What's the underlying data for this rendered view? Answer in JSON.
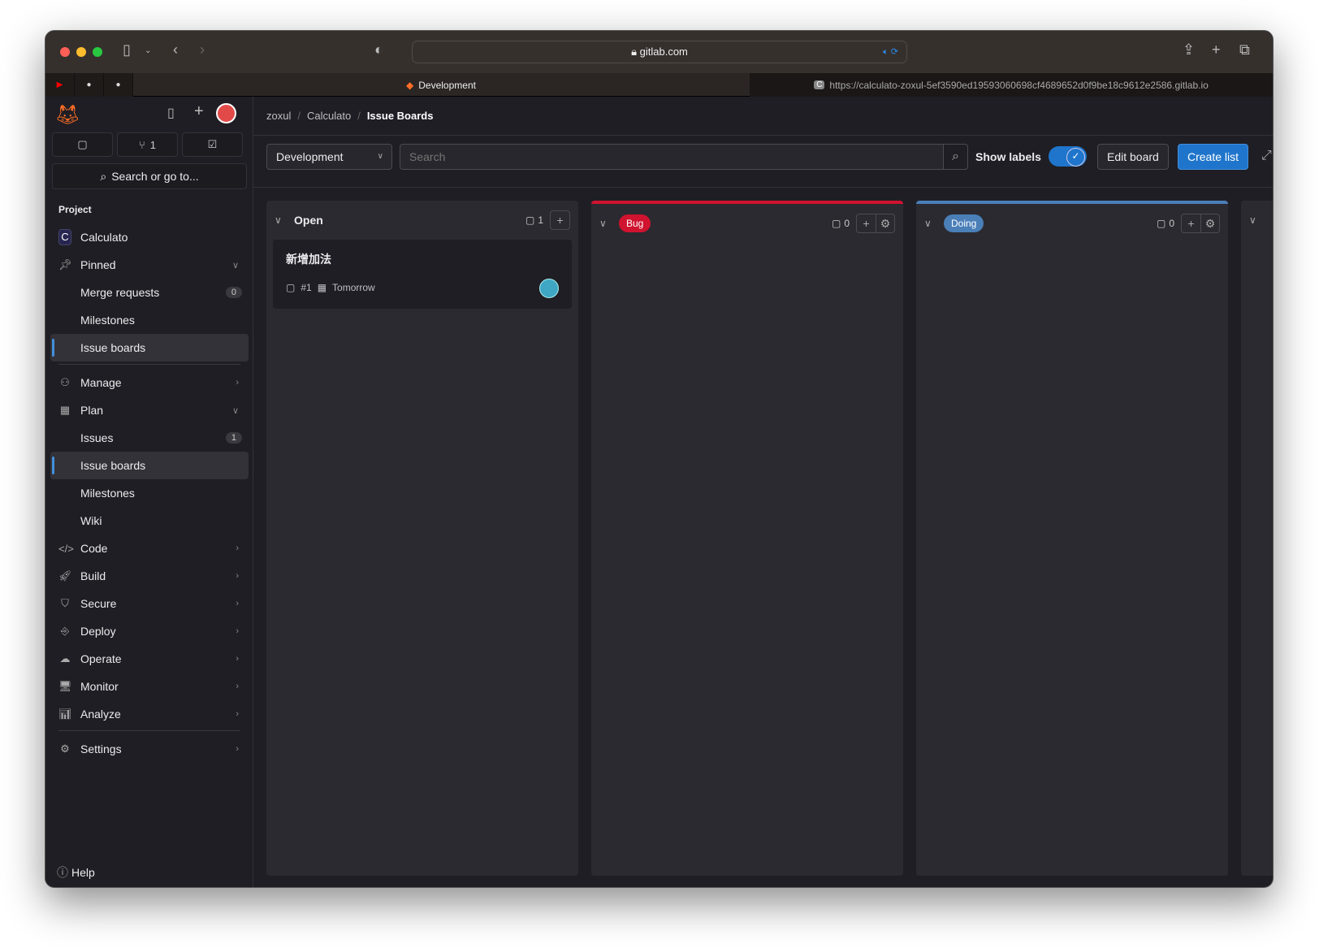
{
  "browser": {
    "url": "gitlab.com",
    "tabs": [
      {
        "title": "Development"
      },
      {
        "title": "https://calculato-zoxul-5ef3590ed19593060698cf4689652d0f9be18c9612e2586.gitlab.io",
        "favicon_letter": "C"
      }
    ]
  },
  "sidebar": {
    "quick": {
      "issues": "",
      "merge_requests": "1",
      "todos": ""
    },
    "search": "Search or go to...",
    "section": "Project",
    "project": {
      "initial": "C",
      "name": "Calculato"
    },
    "pinned": {
      "label": "Pinned",
      "items": [
        {
          "label": "Merge requests",
          "badge": "0"
        },
        {
          "label": "Milestones"
        },
        {
          "label": "Issue boards"
        }
      ]
    },
    "manage": "Manage",
    "plan": {
      "label": "Plan",
      "items": [
        {
          "label": "Issues",
          "badge": "1"
        },
        {
          "label": "Issue boards"
        },
        {
          "label": "Milestones"
        },
        {
          "label": "Wiki"
        }
      ]
    },
    "groups": [
      "Code",
      "Build",
      "Secure",
      "Deploy",
      "Operate",
      "Monitor",
      "Analyze"
    ],
    "settings": "Settings",
    "help": "Help"
  },
  "breadcrumb": [
    "zoxul",
    "Calculato",
    "Issue Boards"
  ],
  "toolbar": {
    "board": "Development",
    "search_placeholder": "Search",
    "show_labels": "Show labels",
    "show_labels_on": true,
    "edit_board": "Edit board",
    "create_list": "Create list"
  },
  "lists": [
    {
      "title": "Open",
      "count": "1",
      "cards": [
        {
          "title": "新增加法",
          "ref": "#1",
          "due": "Tomorrow"
        }
      ]
    },
    {
      "label": "Bug",
      "color": "#dd2b0e",
      "count": "0"
    },
    {
      "label": "Doing",
      "color": "#428fdc",
      "count": "0"
    }
  ],
  "colors": {
    "accent": "#1f75cb",
    "bug": "#d0132f",
    "doing": "#4a7fb8"
  }
}
